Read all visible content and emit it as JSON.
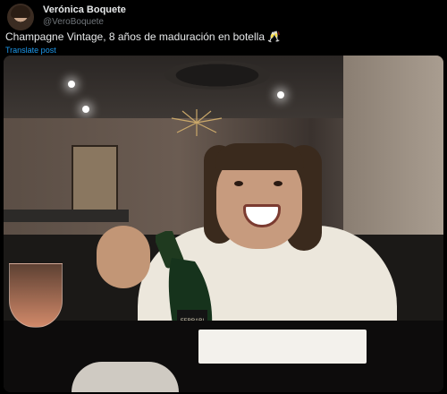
{
  "post": {
    "display_name": "Verónica Boquete",
    "handle": "@VeroBoquete",
    "text": "Champagne Vintage, 8 años de maduración en botella 🥂",
    "translate_label": "Translate post"
  },
  "photo": {
    "bottle_label": "FERRARI"
  },
  "colors": {
    "link": "#1d9bf0",
    "background": "#000000",
    "text": "#e7e9ea",
    "muted": "#71767b"
  }
}
